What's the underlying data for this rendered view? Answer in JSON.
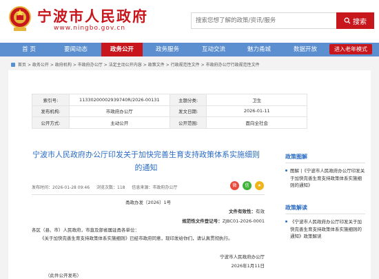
{
  "header": {
    "site_title": "宁波市人民政府",
    "site_url": "www.ningbo.gov.cn",
    "search_placeholder": "搜索您想了解的政策/资讯/服务",
    "search_button": "搜索",
    "brand_color": "#c8161d",
    "nav_color": "#5b8fd0"
  },
  "nav": {
    "items": [
      "首  页",
      "要闻动态",
      "政务公开",
      "政务服务",
      "互动交流",
      "魅力甬城",
      "数据开放"
    ],
    "active_index": 2,
    "elder_mode": "进入老年模式"
  },
  "breadcrumb": [
    "首页",
    "政务公开",
    "政府机构",
    "市政府办公厅",
    "法定主动公开内容",
    "政策文件",
    "行政规范性文件",
    "市政府办公厅行政规范性文件"
  ],
  "meta": {
    "index_no_label": "索引号:",
    "index_no": "11330200002939740R/2026-00131",
    "topic_label": "主题分类:",
    "topic": "卫生",
    "issuer_label": "发布机构:",
    "issuer": "市政府办公厅",
    "date_label": "发文日期:",
    "date": "2026-01-11",
    "mode_label": "公开方式:",
    "mode": "主动公开",
    "scope_label": "公开范围:",
    "scope": "面向全社会"
  },
  "article": {
    "title": "宁波市人民政府办公厅印发关于加快完善生育支持政策体系实施细则的通知",
    "publish_time": "发布时间：2026-01-28 09:46",
    "views": "浏览次数：118",
    "source": "信息来源：市政府办公厅",
    "doc_no": "甬政办发〔2026〕1号",
    "validity_label": "文件有效性：",
    "validity": "有效",
    "reg_label": "规范性文件登记号：",
    "reg_no": "ZJBC01-2026-0001",
    "salutation": "各区（县、市）人民政府，市直及部省属驻甬各单位：",
    "body": "《关于加快完善生育支持政策体系实施细则》已经市政府同意，现印发给你们，请认真贯彻执行。",
    "signer": "宁波市人民政府办公厅",
    "sign_date": "2026年1月11日",
    "printed_note": "（此件公开发布）"
  },
  "share_icons": [
    "weibo-icon",
    "wechat-icon",
    "qzone-icon"
  ],
  "sidebar": {
    "section1_title": "政策图解",
    "section1_link": "图解 |《宁波市人民政府办公厅印发关于加快完善生育支持政策体系实施细则的通知》",
    "section2_title": "政策解读",
    "section2_link": "《宁波市人民政府办公厅印发关于加快完善生育支持政策体系实施细则的通知》政策解读"
  }
}
